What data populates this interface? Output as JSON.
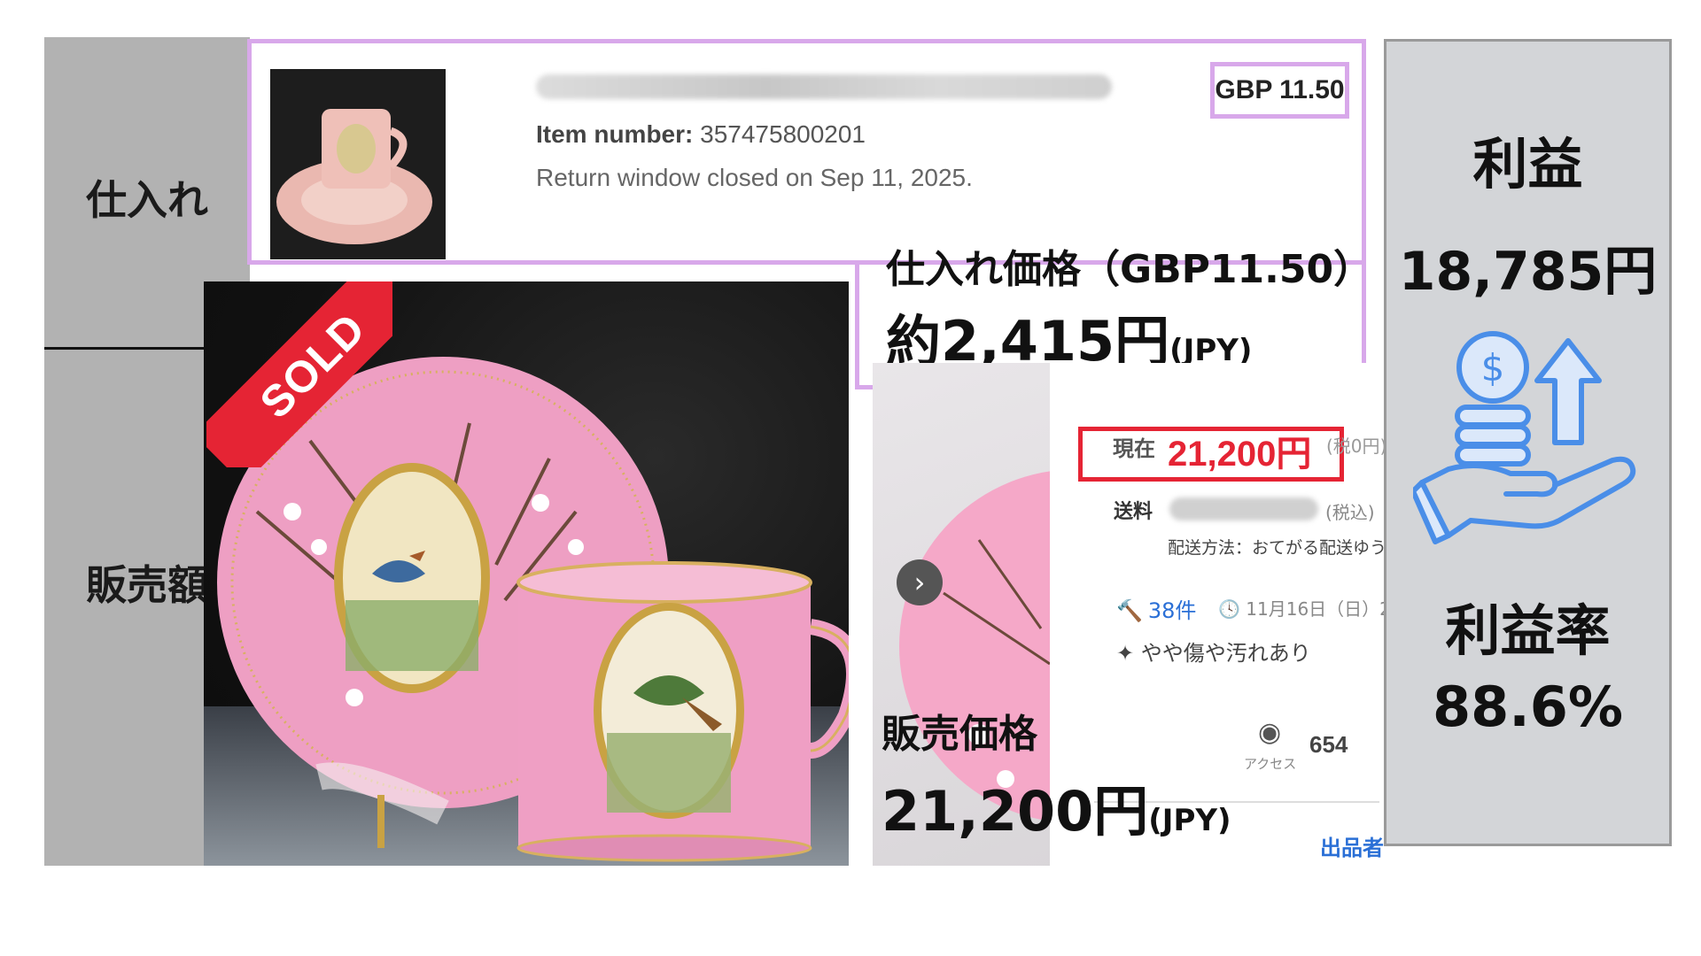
{
  "labels": {
    "purchase": "仕入れ",
    "sales": "販売額"
  },
  "purchase_listing": {
    "price": "GBP 11.50",
    "item_number_label": "Item number:",
    "item_number": "357475800201",
    "return_window": "Return window closed on Sep 11, 2025."
  },
  "cost": {
    "label": "仕入れ価格（GBP11.50）",
    "value": "約2,415円",
    "unit": "(JPY)"
  },
  "photo": {
    "badge": "SOLD"
  },
  "sale_listing": {
    "current_label": "現在",
    "current_price": "21,200円",
    "current_tax": "(税0円)",
    "shipping_label": "送料",
    "shipping_tax": "(税込)",
    "shipping_method": "配送方法：おてがる配送ゆう",
    "bids": "38件",
    "end_time": "11月16日（日）2",
    "condition": "やや傷や汚れあり",
    "access_label": "アクセス",
    "access_count": "654",
    "seller": "出品者",
    "next_arrow": "›"
  },
  "sale": {
    "label": "販売価格",
    "value": "21,200円",
    "unit": "(JPY)"
  },
  "summary": {
    "profit_label": "利益",
    "profit_value": "18,785円",
    "margin_label": "利益率",
    "margin_value": "88.6%"
  },
  "colors": {
    "accent_purple": "#d8a8ea",
    "sold_red": "#e52434",
    "link_blue": "#2a6fd6",
    "icon_blue": "#4a8ee8"
  }
}
